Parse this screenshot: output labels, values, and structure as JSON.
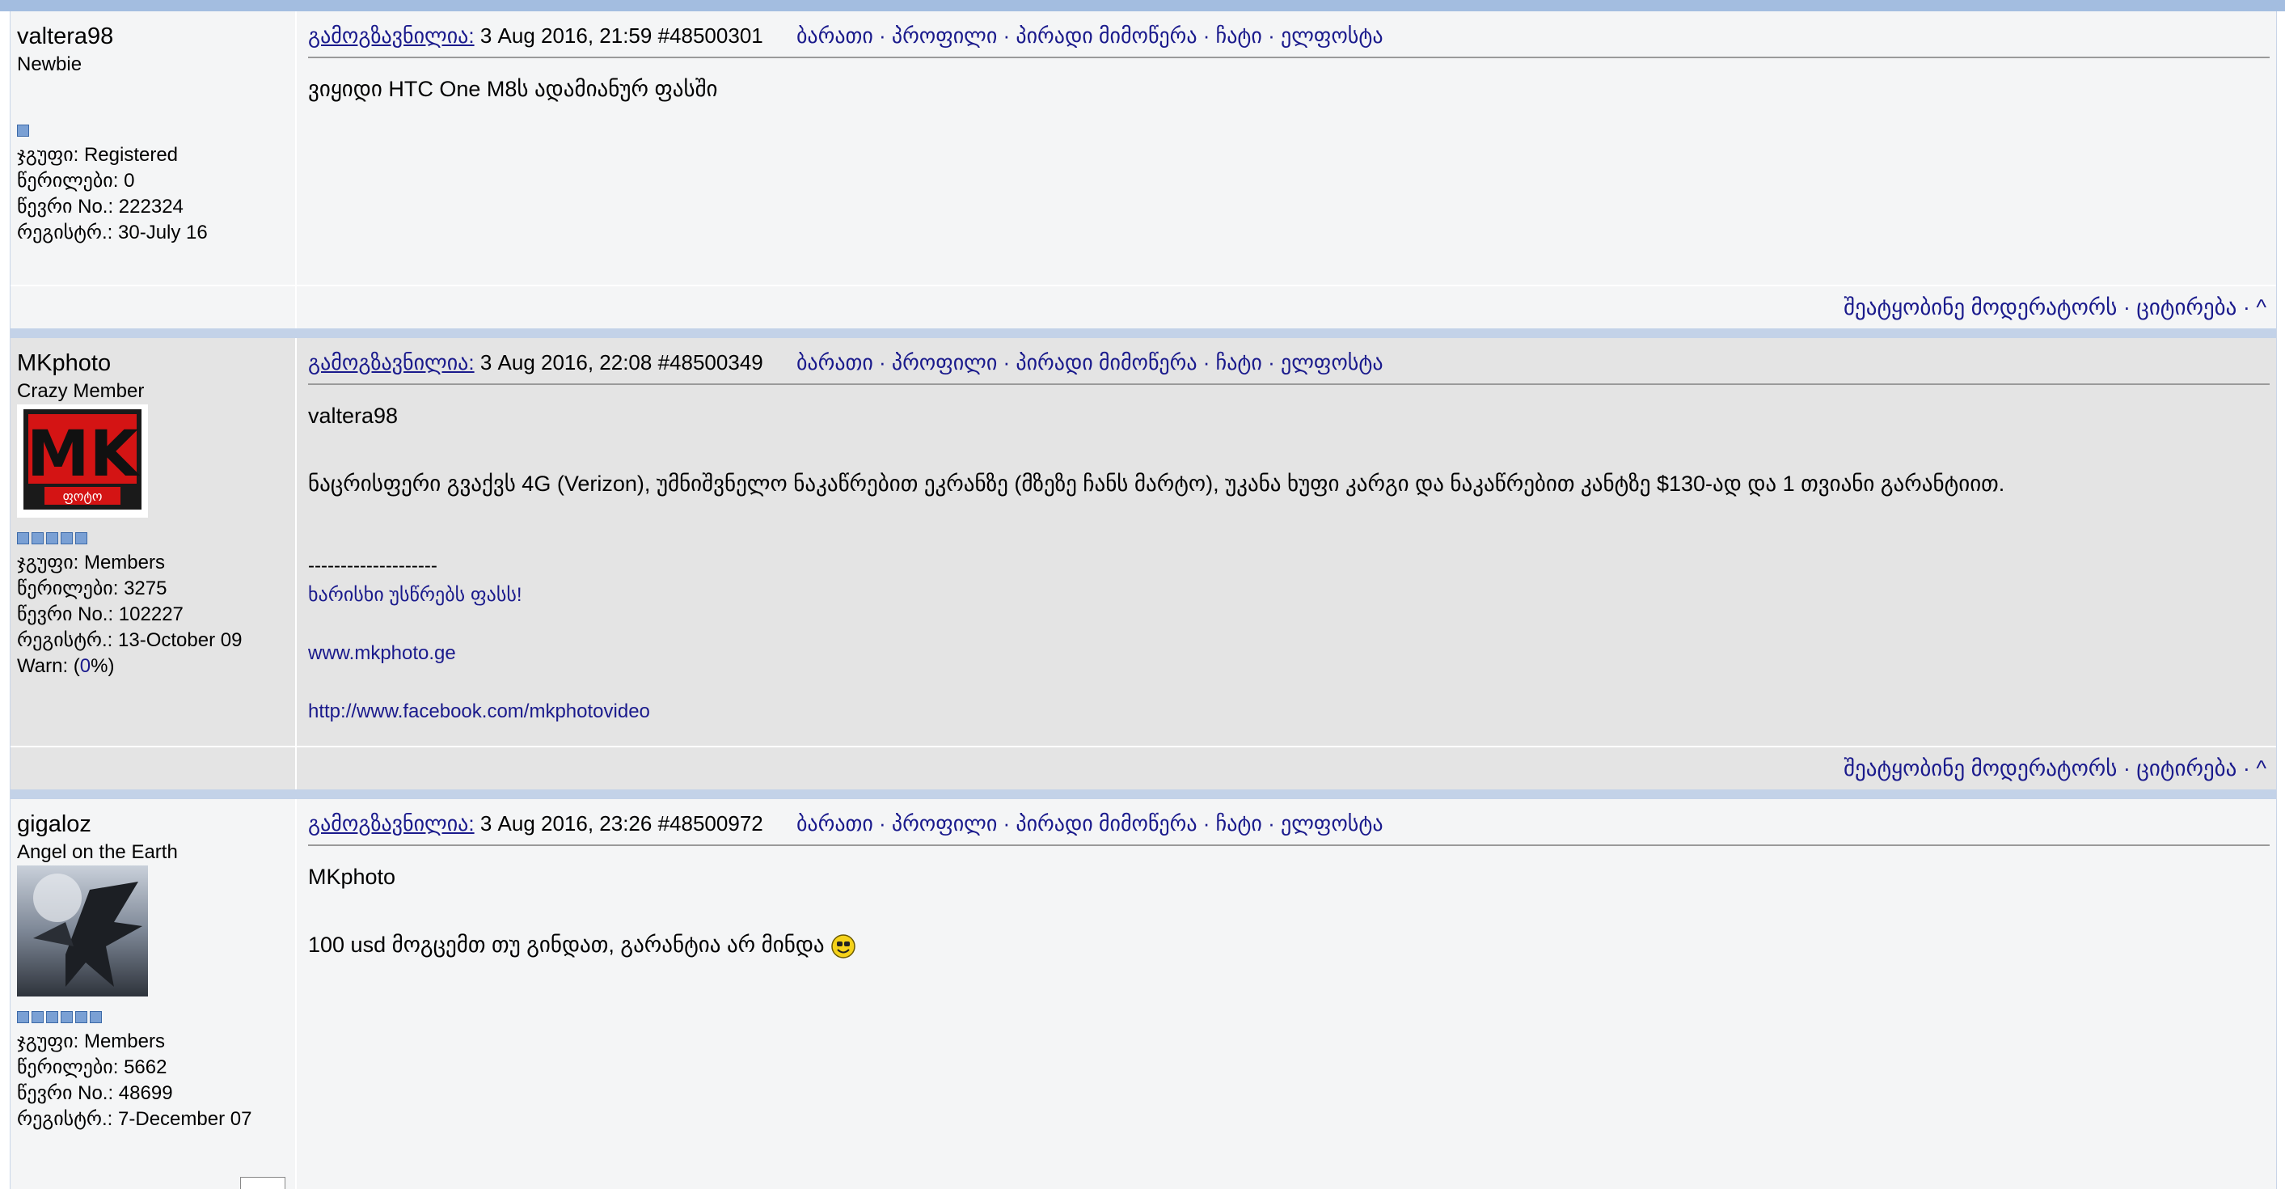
{
  "posts": [
    {
      "user": "valtera98",
      "rank": "Newbie",
      "pips": 1,
      "group_label": "ჯგუფი:",
      "group": "Registered",
      "posts_label": "წერილები:",
      "posts": "0",
      "member_label": "წევრი No.:",
      "member_no": "222324",
      "reg_label": "რეგისტრ.:",
      "reg": "30-July 16",
      "header_label": "გამოგზავნილია:",
      "date": "3 Aug 2016, 21:59",
      "post_id": "#48500301",
      "header_links": "ბარათი · პროფილი · პირადი მიმოწერა · ჩატი · ელფოსტა",
      "body": "ვიყიდი HTC One M8ს ადამიანურ ფასში",
      "footer_links": "შეატყობინე მოდერატორს  · ციტირება · ^"
    },
    {
      "user": "MKphoto",
      "rank": "Crazy Member",
      "avatar_text": "MK",
      "avatar_sub": "ფოტო",
      "pips": 5,
      "group_label": "ჯგუფი:",
      "group": "Members",
      "posts_label": "წერილები:",
      "posts": "3275",
      "member_label": "წევრი No.:",
      "member_no": "102227",
      "reg_label": "რეგისტრ.:",
      "reg": "13-October 09",
      "warn_prefix": "Warn: (",
      "warn_value": "0",
      "warn_suffix": "%)",
      "header_label": "გამოგზავნილია:",
      "date": "3 Aug 2016, 22:08",
      "post_id": "#48500349",
      "header_links": "ბარათი · პროფილი · პირადი მიმოწერა · ჩატი · ელფოსტა",
      "quote_user": "valtera98",
      "body": "ნაცრისფერი გვაქვს 4G (Verizon), უმნიშვნელო ნაკაწრებით ეკრანზე (მზეზე ჩანს მარტო), უკანა ხუფი კარგი და ნაკაწრებით კანტზე $130-ად და 1 თვიანი გარანტიით.",
      "sig_sep": "--------------------",
      "sig_line1": "ხარისხი უსწრებს ფასს!",
      "sig_line2": "www.mkphoto.ge",
      "sig_line3": "http://www.facebook.com/mkphotovideo",
      "footer_links": "შეატყობინე მოდერატორს  · ციტირება · ^"
    },
    {
      "user": "gigaloz",
      "rank": "Angel on the Earth",
      "pips": 6,
      "group_label": "ჯგუფი:",
      "group": "Members",
      "posts_label": "წერილები:",
      "posts": "5662",
      "member_label": "წევრი No.:",
      "member_no": "48699",
      "reg_label": "რეგისტრ.:",
      "reg": "7-December 07",
      "header_label": "გამოგზავნილია:",
      "date": "3 Aug 2016, 23:26",
      "post_id": "#48500972",
      "header_links": "ბარათი · პროფილი · პირადი მიმოწერა · ჩატი · ელფოსტა",
      "quote_user": "MKphoto",
      "body": "100 usd მოგცემთ თუ გინდათ, გარანტია არ მინდა"
    }
  ],
  "colors": {
    "link": "#1a1a8c",
    "separator": "#c3d2e8",
    "top_bar": "#a3bde0"
  }
}
